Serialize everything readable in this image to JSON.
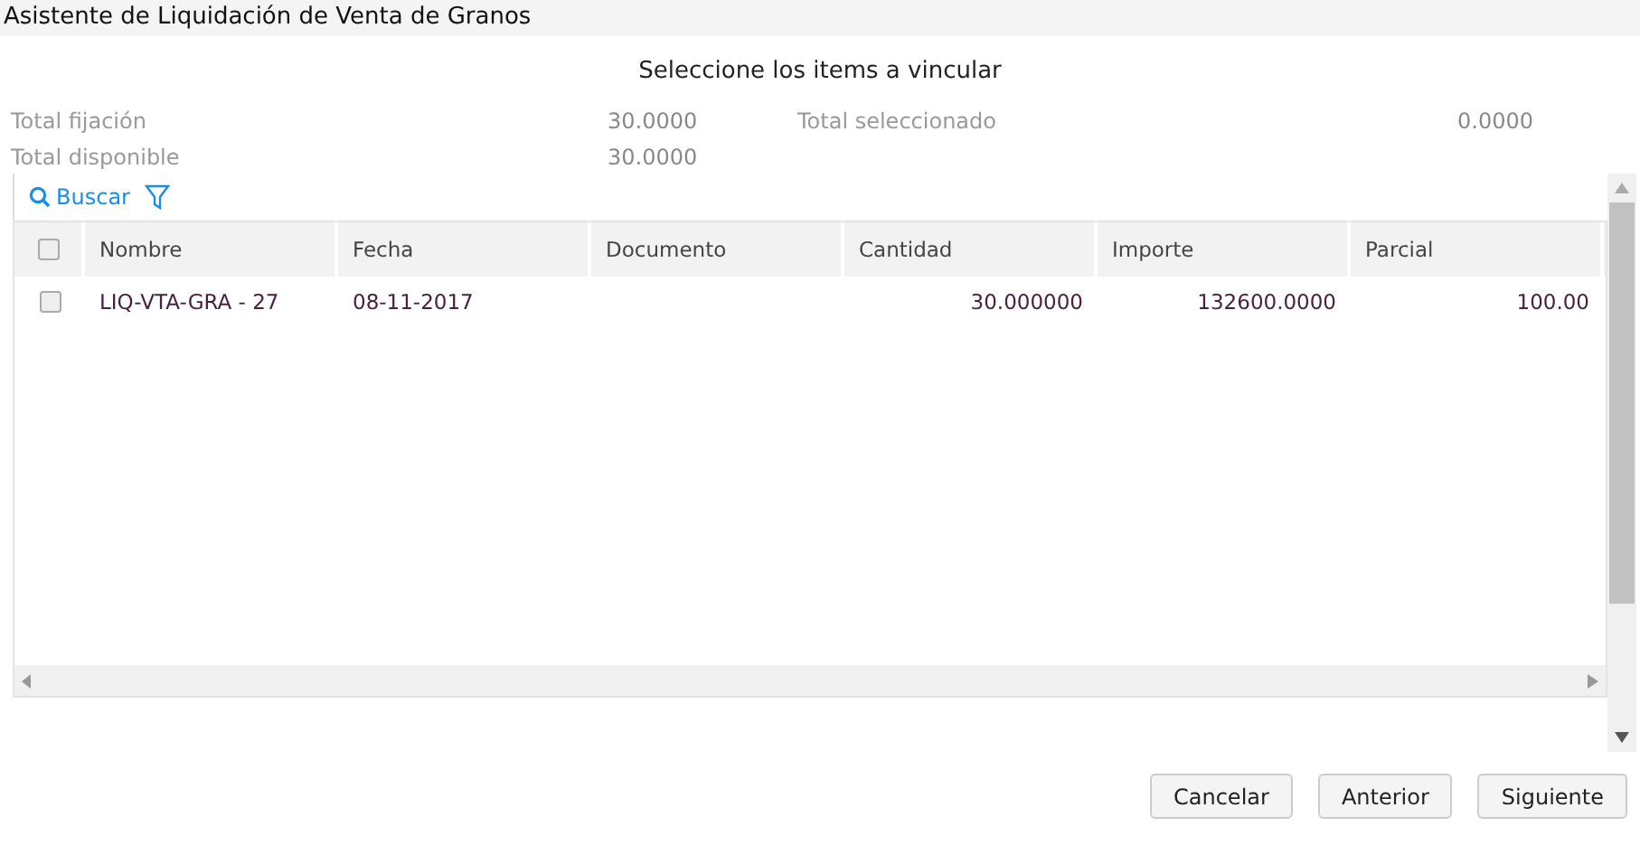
{
  "window": {
    "title": "Asistente de Liquidación de Venta de Granos"
  },
  "heading": "Seleccione los items a vincular",
  "totals": [
    {
      "label": "Total fijación",
      "value": "30.0000"
    },
    {
      "label": "Total seleccionado",
      "value": "0.0000"
    },
    {
      "label": "Total disponible",
      "value": "30.0000"
    }
  ],
  "toolbar": {
    "search": "Buscar"
  },
  "table": {
    "select_all": {
      "checked": false
    },
    "columns": [
      {
        "label": "Nombre",
        "kind": "text"
      },
      {
        "label": "Fecha",
        "kind": "text"
      },
      {
        "label": "Documento",
        "kind": "text"
      },
      {
        "label": "Cantidad",
        "kind": "number"
      },
      {
        "label": "Importe",
        "kind": "number"
      },
      {
        "label": "Parcial",
        "kind": "number"
      }
    ],
    "rows": [
      {
        "checked": false,
        "cells": [
          "LIQ-VTA-GRA - 27",
          "08-11-2017",
          "",
          "30.000000",
          "132600.0000",
          "100.00"
        ]
      }
    ]
  },
  "buttons": [
    "Cancelar",
    "Anterior",
    "Siguiente"
  ]
}
